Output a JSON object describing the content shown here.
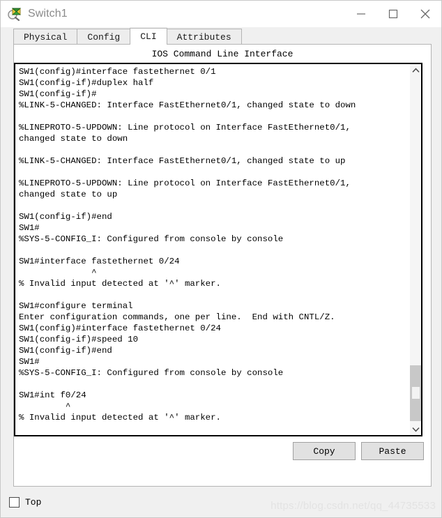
{
  "window": {
    "title": "Switch1",
    "icon": "switch-magnifier-icon",
    "controls": {
      "minimize": "minimize-icon",
      "maximize": "maximize-icon",
      "close": "close-icon"
    }
  },
  "tabs": [
    {
      "label": "Physical",
      "active": false
    },
    {
      "label": "Config",
      "active": false
    },
    {
      "label": "CLI",
      "active": true
    },
    {
      "label": "Attributes",
      "active": false
    }
  ],
  "panel": {
    "title": "IOS Command Line Interface"
  },
  "terminal": {
    "lines": [
      "SW1(config)#interface fastethernet 0/1",
      "SW1(config-if)#duplex half",
      "SW1(config-if)#",
      "%LINK-5-CHANGED: Interface FastEthernet0/1, changed state to down",
      "",
      "%LINEPROTO-5-UPDOWN: Line protocol on Interface FastEthernet0/1,",
      "changed state to down",
      "",
      "%LINK-5-CHANGED: Interface FastEthernet0/1, changed state to up",
      "",
      "%LINEPROTO-5-UPDOWN: Line protocol on Interface FastEthernet0/1,",
      "changed state to up",
      "",
      "SW1(config-if)#end",
      "SW1#",
      "%SYS-5-CONFIG_I: Configured from console by console",
      "",
      "SW1#interface fastethernet 0/24",
      "              ^",
      "% Invalid input detected at '^' marker.",
      "",
      "SW1#configure terminal",
      "Enter configuration commands, one per line.  End with CNTL/Z.",
      "SW1(config)#interface fastethernet 0/24",
      "SW1(config-if)#speed 10",
      "SW1(config-if)#end",
      "SW1#",
      "%SYS-5-CONFIG_I: Configured from console by console",
      "",
      "SW1#int f0/24",
      "         ^",
      "% Invalid input detected at '^' marker.",
      ""
    ],
    "partial_last_line": "^",
    "scrollbar": {
      "up_arrow": "chevron-up-icon",
      "down_arrow": "chevron-down-icon"
    }
  },
  "actions": {
    "copy_label": "Copy",
    "paste_label": "Paste"
  },
  "footer": {
    "top_checkbox_label": "Top",
    "top_checked": false,
    "watermark": "https://blog.csdn.net/qq_44735533"
  },
  "colors": {
    "window_bg": "#f0f0f0",
    "panel_bg": "#ffffff",
    "terminal_border": "#000000",
    "button_face": "#e1e1e1",
    "title_text": "#8a8a8a",
    "watermark": "#e3e3e3",
    "scrollbar_thumb": "#c8c8c8"
  }
}
